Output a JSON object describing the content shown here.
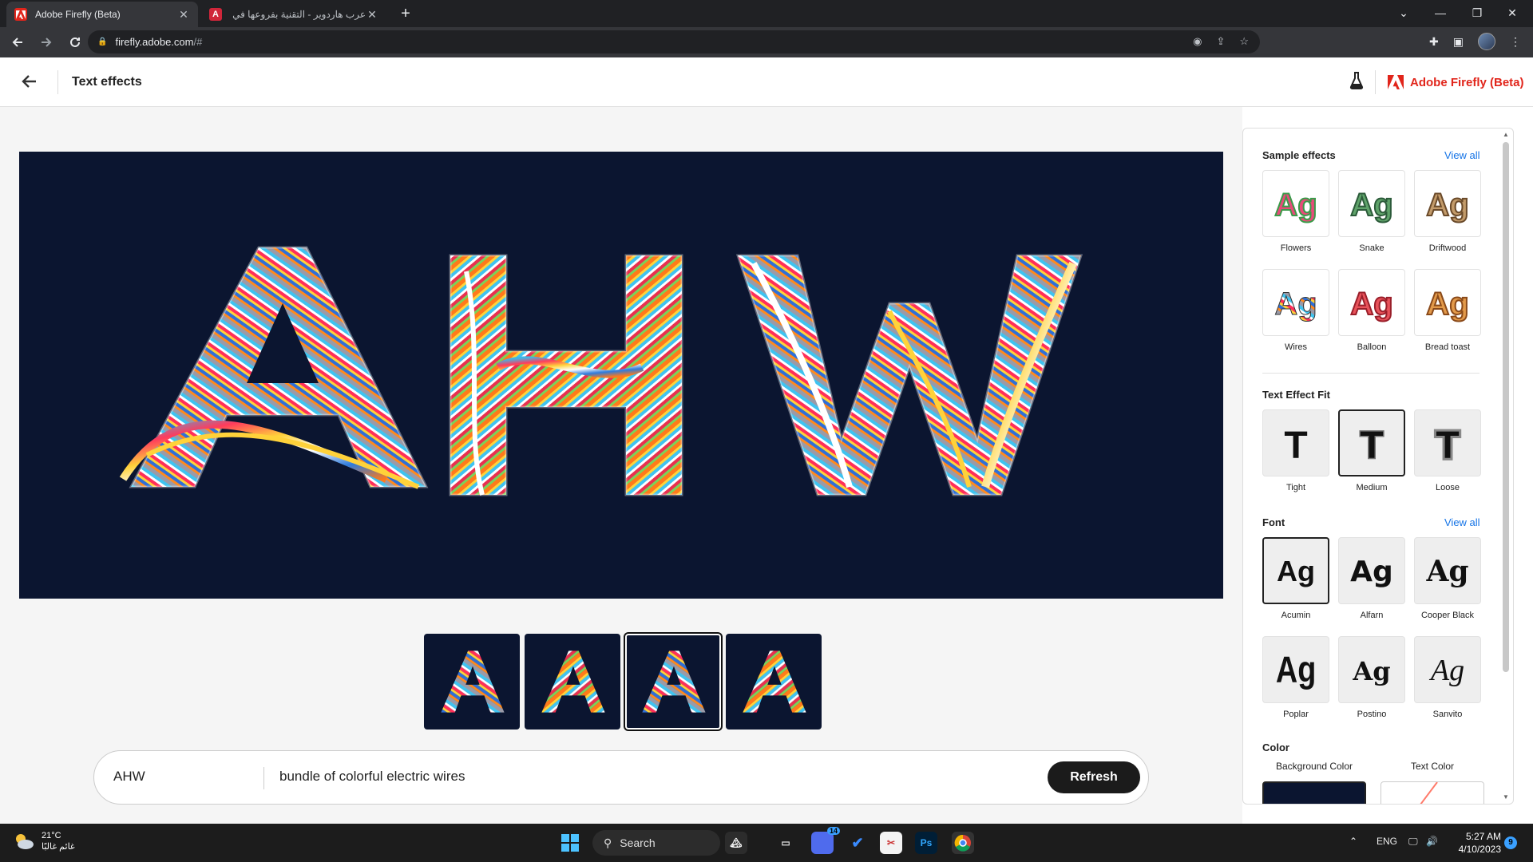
{
  "browser": {
    "tabs": [
      {
        "title": "Adobe Firefly (Beta)",
        "active": true
      },
      {
        "title": "عرب هاردوير - التقنية بفروعها في ...",
        "active": false
      }
    ],
    "new_tab": "+",
    "url_host": "firefly.adobe.com",
    "url_path": "/#",
    "window_controls": {
      "minimize": "—",
      "maximize": "❐",
      "close": "✕",
      "tab_search": "⌄"
    }
  },
  "header": {
    "title": "Text effects",
    "brand": "Adobe Firefly (Beta)"
  },
  "canvas": {
    "text": "AHW",
    "background": "#0b1530",
    "thumbnail_letter": "A",
    "thumbnail_count": 4,
    "selected_thumbnail": 2
  },
  "prompt": {
    "text_value": "AHW",
    "description": "bundle of colorful electric wires",
    "refresh_label": "Refresh"
  },
  "panel": {
    "sample_effects": {
      "title": "Sample effects",
      "view_all": "View all",
      "items": [
        {
          "label": "Flowers",
          "glyph": "Ag"
        },
        {
          "label": "Snake",
          "glyph": "Ag"
        },
        {
          "label": "Driftwood",
          "glyph": "Ag"
        },
        {
          "label": "Wires",
          "glyph": "Ag"
        },
        {
          "label": "Balloon",
          "glyph": "Ag"
        },
        {
          "label": "Bread toast",
          "glyph": "Ag"
        }
      ]
    },
    "fit": {
      "title": "Text Effect Fit",
      "items": [
        {
          "label": "Tight",
          "glyph": "T"
        },
        {
          "label": "Medium",
          "glyph": "T"
        },
        {
          "label": "Loose",
          "glyph": "T"
        }
      ],
      "selected": "Medium"
    },
    "font": {
      "title": "Font",
      "view_all": "View all",
      "items": [
        {
          "label": "Acumin",
          "glyph": "Ag"
        },
        {
          "label": "Alfarn",
          "glyph": "Ag"
        },
        {
          "label": "Cooper Black",
          "glyph": "Ag"
        },
        {
          "label": "Poplar",
          "glyph": "Ag"
        },
        {
          "label": "Postino",
          "glyph": "Ag"
        },
        {
          "label": "Sanvito",
          "glyph": "Ag"
        }
      ],
      "selected": "Acumin"
    },
    "color": {
      "title": "Color",
      "background_label": "Background Color",
      "text_label": "Text Color",
      "background_value": "#0b1530"
    }
  },
  "taskbar": {
    "weather_temp": "21°C",
    "weather_desc": "غائم غالبًا",
    "search_label": "Search",
    "chat_badge": "14",
    "ps_label": "Ps",
    "lang": "ENG",
    "time": "5:27 AM",
    "date": "4/10/2023",
    "notification_count": "9"
  },
  "colors": {
    "accent": "#1473e6",
    "brand_red": "#e1251b",
    "refresh_button": "#1b1b1b"
  }
}
